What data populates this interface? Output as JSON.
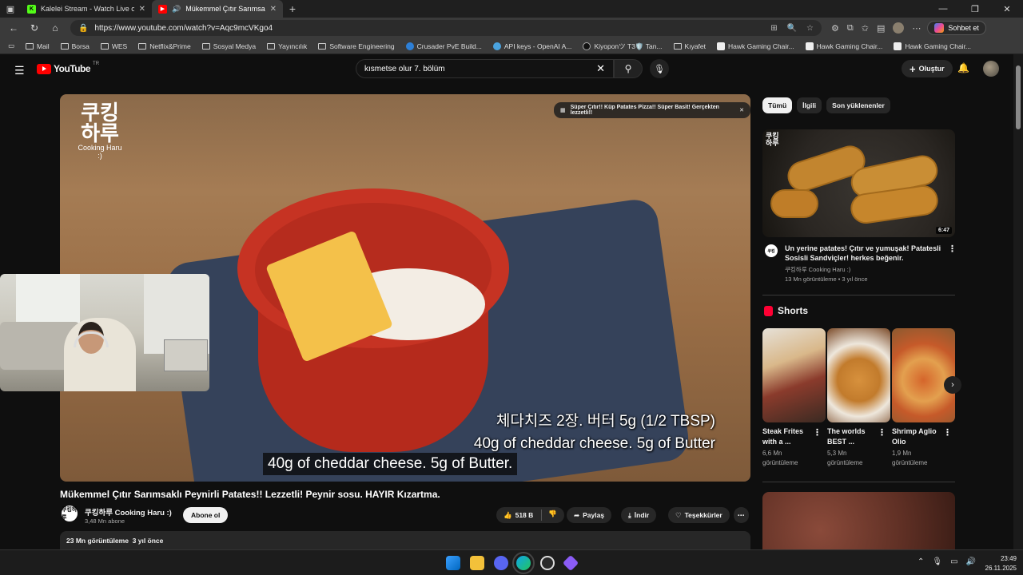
{
  "browser": {
    "tabs": [
      {
        "title": "Kalelei Stream - Watch Live on Kic",
        "fav": "K",
        "fav_color": "#53fc18",
        "active": false
      },
      {
        "title": "Mükemmel Çıtır Sarımsaklı P",
        "fav": "▶",
        "fav_color": "#ff0000",
        "active": true
      }
    ],
    "url": "https://www.youtube.com/watch?v=Aqc9mcVKgo4",
    "copilot_label": "Sohbet et",
    "bookmarks": [
      "Mail",
      "Borsa",
      "WES",
      "Netflix&Prime",
      "Sosyal Medya",
      "Yayıncılık",
      "Software Engineering",
      "Crusader PvE Build...",
      "API keys - OpenAI A...",
      "Kiyoponツ T3🛡️ Tan...",
      "Kıyafet",
      "Hawk Gaming Chair...",
      "Hawk Gaming Chair...",
      "Hawk Gaming Chair..."
    ]
  },
  "youtube": {
    "logo_text": "YouTube",
    "region": "TR",
    "search_value": "kısmetse olur 7. bölüm",
    "create_label": "Oluştur"
  },
  "video": {
    "watermark_kr": "쿠킹\n하루",
    "watermark_en": "Cooking Haru :)",
    "toast": "Süper Çıtır!! Küp Patates Pizza!! Süper Basit! Gerçekten lezzetli!!",
    "subtitle_kr": "체다치즈 2장. 버터 5g (1/2 TBSP)",
    "subtitle_en": "40g of cheddar cheese. 5g of Butter",
    "cc_text": "40g of cheddar cheese. 5g of Butter.",
    "title": "Mükemmel Çıtır Sarımsaklı Peynirli Patates!! Lezzetli! Peynir sosu. HAYIR Kızartma.",
    "channel_avatar": "쿠킹하루",
    "channel": "쿠킹하루 Cooking Haru :)",
    "subscribers": "3,48 Mn abone",
    "subscribe_label": "Abone ol",
    "likes": "518 B",
    "share_label": "Paylaş",
    "download_label": "İndir",
    "thanks_label": "Teşekkürler",
    "views_date": "23 Mn görüntüleme  3 yıl önce"
  },
  "sidebar": {
    "chips": [
      "Tümü",
      "İlgili",
      "Son yüklenenler"
    ],
    "related": {
      "title": "Un yerine patates! Çıtır ve yumuşak! Patatesli Sosisli Sandviçler! herkes beğenir.",
      "channel": "쿠킹하루 Cooking Haru :)",
      "meta": "13 Mn görüntüleme • 3 yıl önce",
      "duration": "6:47",
      "watermark": "쿠킹\n하루"
    },
    "shorts_heading": "Shorts",
    "shorts": [
      {
        "title": "Steak Frites with a ...",
        "views": "6,6 Mn görüntüleme"
      },
      {
        "title": "The worlds BEST ...",
        "views": "5,3 Mn görüntüleme"
      },
      {
        "title": "Shrimp Aglio Olio",
        "views": "1,9 Mn görüntüleme"
      }
    ]
  },
  "taskbar": {
    "time": "23:49",
    "date": "26.11.2025"
  }
}
